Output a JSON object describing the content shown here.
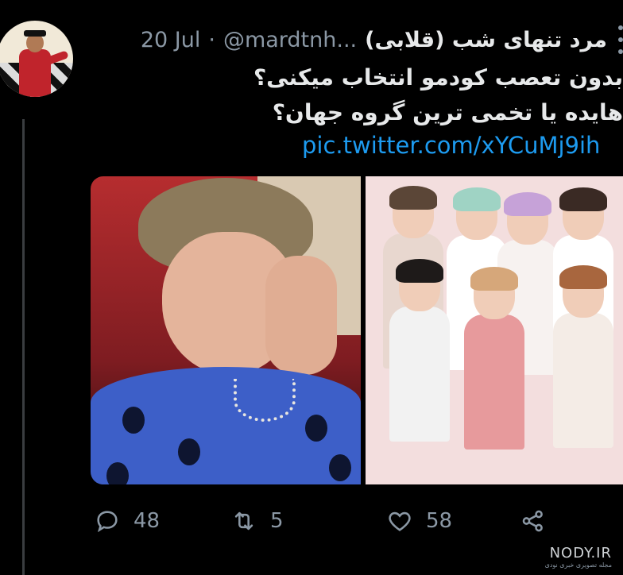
{
  "tweet": {
    "display_name": "مرد تنهای شب (قلابی)",
    "handle": "@mardtnh...",
    "separator": "·",
    "timestamp": "20 Jul",
    "lines": [
      "بدون تعصب کودمو انتخاب میکنی؟",
      "هایده یا تخمی ترین گروه جهان؟"
    ],
    "link": "pic.twitter.com/xYCuMj9ih"
  },
  "actions": {
    "reply_count": "48",
    "retweet_count": "5",
    "like_count": "58"
  },
  "icons": {
    "more": "more-vertical-icon",
    "reply": "reply-icon",
    "retweet": "retweet-icon",
    "like": "heart-icon",
    "share": "share-icon"
  },
  "colors": {
    "background": "#000000",
    "text": "#e7e9ea",
    "secondary": "#8b98a5",
    "link": "#1d9bf0"
  },
  "watermark": {
    "name": "NODY.IR",
    "subtitle": "مجله تصویری خبری نودی"
  }
}
